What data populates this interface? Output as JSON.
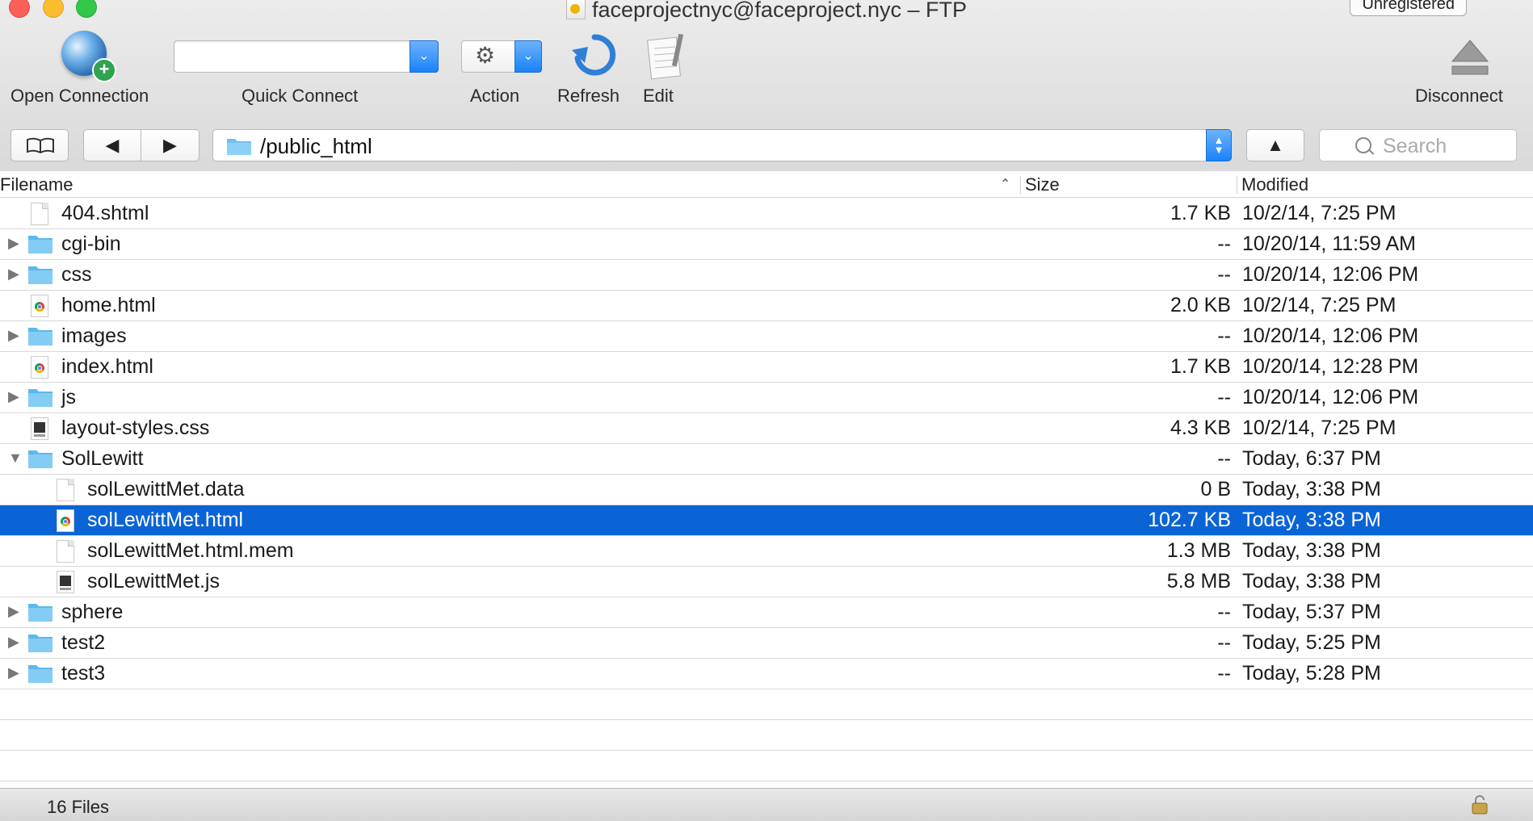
{
  "window": {
    "title": "faceprojectnyc@faceproject.nyc – FTP",
    "badge": "Unregistered"
  },
  "toolbar": {
    "open_connection": "Open Connection",
    "quick_connect": "Quick Connect",
    "quick_connect_value": "",
    "action": "Action",
    "refresh": "Refresh",
    "edit": "Edit",
    "disconnect": "Disconnect"
  },
  "nav": {
    "path": "/public_html",
    "search_placeholder": "Search"
  },
  "columns": {
    "filename": "Filename",
    "size": "Size",
    "modified": "Modified"
  },
  "files": [
    {
      "name": "404.shtml",
      "size": "1.7 KB",
      "modified": "10/2/14, 7:25 PM",
      "icon": "file-icon"
    },
    {
      "name": "cgi-bin",
      "size": "--",
      "modified": "10/20/14, 11:59 AM",
      "icon": "folder-icon"
    },
    {
      "name": "css",
      "size": "--",
      "modified": "10/20/14, 12:06 PM",
      "icon": "folder-icon"
    },
    {
      "name": "home.html",
      "size": "2.0 KB",
      "modified": "10/2/14, 7:25 PM",
      "icon": "html-file-icon"
    },
    {
      "name": "images",
      "size": "--",
      "modified": "10/20/14, 12:06 PM",
      "icon": "folder-icon"
    },
    {
      "name": "index.html",
      "size": "1.7 KB",
      "modified": "10/20/14, 12:28 PM",
      "icon": "html-file-icon"
    },
    {
      "name": "js",
      "size": "--",
      "modified": "10/20/14, 12:06 PM",
      "icon": "folder-icon"
    },
    {
      "name": "layout-styles.css",
      "size": "4.3 KB",
      "modified": "10/2/14, 7:25 PM",
      "icon": "css-file-icon"
    },
    {
      "name": "SolLewitt",
      "size": "--",
      "modified": "Today, 6:37 PM",
      "icon": "folder-icon",
      "expanded": true
    },
    {
      "name": "solLewittMet.data",
      "size": "0 B",
      "modified": "Today, 3:38 PM",
      "icon": "file-icon"
    },
    {
      "name": "solLewittMet.html",
      "size": "102.7 KB",
      "modified": "Today, 3:38 PM",
      "icon": "html-file-icon",
      "selected": true
    },
    {
      "name": "solLewittMet.html.mem",
      "size": "1.3 MB",
      "modified": "Today, 3:38 PM",
      "icon": "file-icon"
    },
    {
      "name": "solLewittMet.js",
      "size": "5.8 MB",
      "modified": "Today, 3:38 PM",
      "icon": "js-file-icon"
    },
    {
      "name": "sphere",
      "size": "--",
      "modified": "Today, 5:37 PM",
      "icon": "folder-icon"
    },
    {
      "name": "test2",
      "size": "--",
      "modified": "Today, 5:25 PM",
      "icon": "folder-icon"
    },
    {
      "name": "test3",
      "size": "--",
      "modified": "Today, 5:28 PM",
      "icon": "folder-icon"
    }
  ],
  "status": {
    "file_count": "16 Files"
  },
  "colors": {
    "selection": "#0b64d5",
    "folder": "#5ab8ef",
    "accent": "#1a82fb"
  }
}
